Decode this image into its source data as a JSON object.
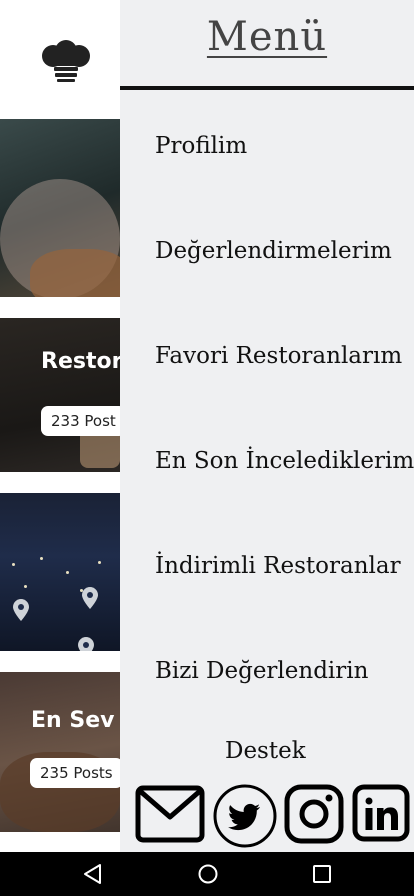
{
  "background": {
    "logo_icon": "chef-hat-icon",
    "cards": [
      {
        "title": "",
        "posts": ""
      },
      {
        "title": "Restor",
        "posts": "233 Post"
      },
      {
        "title": "",
        "posts": ""
      },
      {
        "title": "En Sev",
        "posts": "235 Posts"
      }
    ]
  },
  "drawer": {
    "title": "Menü",
    "items": [
      {
        "label": "Profilim"
      },
      {
        "label": "Değerlendirmelerim"
      },
      {
        "label": "Favori Restoranlarım"
      },
      {
        "label": "En Son İncelediklerim"
      },
      {
        "label": "İndirimli Restoranlar"
      },
      {
        "label": "Bizi Değerlendirin"
      }
    ],
    "support_label": "Destek",
    "social_icons": [
      "mail-icon",
      "twitter-icon",
      "instagram-icon",
      "linkedin-icon"
    ]
  },
  "system_nav": {
    "icons": [
      "back-icon",
      "home-icon",
      "recents-icon"
    ]
  },
  "colors": {
    "drawer_bg": "#eff0f2",
    "text": "#111111",
    "title": "#444444",
    "navbar": "#000000"
  }
}
